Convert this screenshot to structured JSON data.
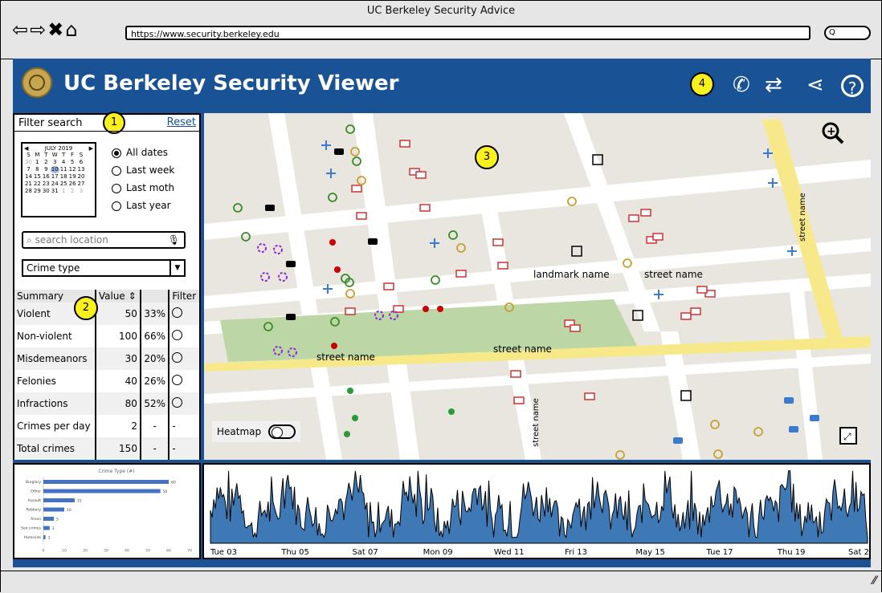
{
  "browser": {
    "title": "UC Berkeley Security Advice",
    "url": "https://www.security.berkeley.edu",
    "search_glyph": "Q"
  },
  "header": {
    "title": "UC Berkeley Security Viewer",
    "callout": "4"
  },
  "filter": {
    "label": "Filter search",
    "reset": "Reset",
    "callout": "1",
    "calendar": {
      "month": "JULY 2019",
      "weekdays": [
        "S",
        "M",
        "T",
        "W",
        "T",
        "F",
        "S"
      ],
      "rows": [
        [
          "30",
          "1",
          "2",
          "3",
          "4",
          "5",
          "6"
        ],
        [
          "7",
          "8",
          "9",
          "10",
          "11",
          "12",
          "13"
        ],
        [
          "14",
          "15",
          "16",
          "17",
          "18",
          "19",
          "20"
        ],
        [
          "21",
          "22",
          "23",
          "24",
          "25",
          "26",
          "27"
        ],
        [
          "28",
          "29",
          "30",
          "31",
          "1",
          "2",
          "3"
        ]
      ],
      "selected": "10"
    },
    "ranges": [
      "All dates",
      "Last week",
      "Last moth",
      "Last year"
    ],
    "selected_range": "All dates",
    "search_placeholder": "search location",
    "crime_type": "Crime type"
  },
  "summary": {
    "callout": "2",
    "headers": [
      "Summary",
      "Value",
      "",
      "Filter"
    ],
    "rows": [
      {
        "label": "Violent",
        "value": "50",
        "pct": "33%"
      },
      {
        "label": "Non-violent",
        "value": "100",
        "pct": "66%"
      },
      {
        "label": "Misdemeanors",
        "value": "30",
        "pct": "20%"
      },
      {
        "label": "Felonies",
        "value": "40",
        "pct": "26%"
      },
      {
        "label": "Infractions",
        "value": "80",
        "pct": "52%"
      },
      {
        "label": "Crimes per day",
        "value": "2",
        "pct": "-"
      },
      {
        "label": "Total crimes",
        "value": "150",
        "pct": "-"
      }
    ]
  },
  "map": {
    "callout": "3",
    "labels": [
      "landmark name",
      "street name",
      "street name",
      "street name",
      "street name",
      "street name",
      "street name"
    ],
    "heatmap_label": "Heatmap",
    "heatmap_on": false
  },
  "chart_data": [
    {
      "type": "bar",
      "title": "Crime Type (#)",
      "categories": [
        "Burglary",
        "Other",
        "Assault",
        "Robbery",
        "Arson",
        "Sex crimes",
        "Homicide"
      ],
      "values": [
        60,
        56,
        15,
        10,
        5,
        3,
        1
      ],
      "xlim": [
        0,
        70
      ],
      "xticks": [
        0,
        10,
        20,
        30,
        40,
        50,
        60,
        70
      ],
      "orientation": "horizontal",
      "color": "#4472c4"
    },
    {
      "type": "area",
      "xticks": [
        "Tue 03",
        "Thu 05",
        "Sat 07",
        "Mon 09",
        "Wed 11",
        "Fri 13",
        "May 15",
        "Tue 17",
        "Thu 19",
        "Sat 21"
      ],
      "color": "#3e78b5"
    }
  ],
  "colors": {
    "app_bg": "#1a5296",
    "callout": "#f9f01e",
    "road_yellow": "#f7e98a",
    "park": "#bcd6a5"
  }
}
